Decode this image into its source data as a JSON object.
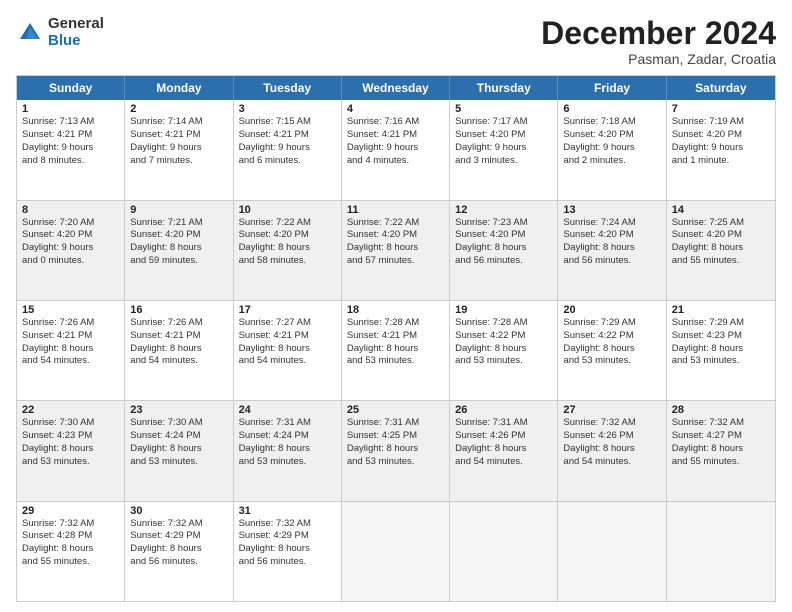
{
  "header": {
    "logo_general": "General",
    "logo_blue": "Blue",
    "title": "December 2024",
    "location": "Pasman, Zadar, Croatia"
  },
  "days_of_week": [
    "Sunday",
    "Monday",
    "Tuesday",
    "Wednesday",
    "Thursday",
    "Friday",
    "Saturday"
  ],
  "weeks": [
    [
      {
        "day": "1",
        "lines": [
          "Sunrise: 7:13 AM",
          "Sunset: 4:21 PM",
          "Daylight: 9 hours",
          "and 8 minutes."
        ],
        "shaded": false
      },
      {
        "day": "2",
        "lines": [
          "Sunrise: 7:14 AM",
          "Sunset: 4:21 PM",
          "Daylight: 9 hours",
          "and 7 minutes."
        ],
        "shaded": false
      },
      {
        "day": "3",
        "lines": [
          "Sunrise: 7:15 AM",
          "Sunset: 4:21 PM",
          "Daylight: 9 hours",
          "and 6 minutes."
        ],
        "shaded": false
      },
      {
        "day": "4",
        "lines": [
          "Sunrise: 7:16 AM",
          "Sunset: 4:21 PM",
          "Daylight: 9 hours",
          "and 4 minutes."
        ],
        "shaded": false
      },
      {
        "day": "5",
        "lines": [
          "Sunrise: 7:17 AM",
          "Sunset: 4:20 PM",
          "Daylight: 9 hours",
          "and 3 minutes."
        ],
        "shaded": false
      },
      {
        "day": "6",
        "lines": [
          "Sunrise: 7:18 AM",
          "Sunset: 4:20 PM",
          "Daylight: 9 hours",
          "and 2 minutes."
        ],
        "shaded": false
      },
      {
        "day": "7",
        "lines": [
          "Sunrise: 7:19 AM",
          "Sunset: 4:20 PM",
          "Daylight: 9 hours",
          "and 1 minute."
        ],
        "shaded": false
      }
    ],
    [
      {
        "day": "8",
        "lines": [
          "Sunrise: 7:20 AM",
          "Sunset: 4:20 PM",
          "Daylight: 9 hours",
          "and 0 minutes."
        ],
        "shaded": true
      },
      {
        "day": "9",
        "lines": [
          "Sunrise: 7:21 AM",
          "Sunset: 4:20 PM",
          "Daylight: 8 hours",
          "and 59 minutes."
        ],
        "shaded": true
      },
      {
        "day": "10",
        "lines": [
          "Sunrise: 7:22 AM",
          "Sunset: 4:20 PM",
          "Daylight: 8 hours",
          "and 58 minutes."
        ],
        "shaded": true
      },
      {
        "day": "11",
        "lines": [
          "Sunrise: 7:22 AM",
          "Sunset: 4:20 PM",
          "Daylight: 8 hours",
          "and 57 minutes."
        ],
        "shaded": true
      },
      {
        "day": "12",
        "lines": [
          "Sunrise: 7:23 AM",
          "Sunset: 4:20 PM",
          "Daylight: 8 hours",
          "and 56 minutes."
        ],
        "shaded": true
      },
      {
        "day": "13",
        "lines": [
          "Sunrise: 7:24 AM",
          "Sunset: 4:20 PM",
          "Daylight: 8 hours",
          "and 56 minutes."
        ],
        "shaded": true
      },
      {
        "day": "14",
        "lines": [
          "Sunrise: 7:25 AM",
          "Sunset: 4:20 PM",
          "Daylight: 8 hours",
          "and 55 minutes."
        ],
        "shaded": true
      }
    ],
    [
      {
        "day": "15",
        "lines": [
          "Sunrise: 7:26 AM",
          "Sunset: 4:21 PM",
          "Daylight: 8 hours",
          "and 54 minutes."
        ],
        "shaded": false
      },
      {
        "day": "16",
        "lines": [
          "Sunrise: 7:26 AM",
          "Sunset: 4:21 PM",
          "Daylight: 8 hours",
          "and 54 minutes."
        ],
        "shaded": false
      },
      {
        "day": "17",
        "lines": [
          "Sunrise: 7:27 AM",
          "Sunset: 4:21 PM",
          "Daylight: 8 hours",
          "and 54 minutes."
        ],
        "shaded": false
      },
      {
        "day": "18",
        "lines": [
          "Sunrise: 7:28 AM",
          "Sunset: 4:21 PM",
          "Daylight: 8 hours",
          "and 53 minutes."
        ],
        "shaded": false
      },
      {
        "day": "19",
        "lines": [
          "Sunrise: 7:28 AM",
          "Sunset: 4:22 PM",
          "Daylight: 8 hours",
          "and 53 minutes."
        ],
        "shaded": false
      },
      {
        "day": "20",
        "lines": [
          "Sunrise: 7:29 AM",
          "Sunset: 4:22 PM",
          "Daylight: 8 hours",
          "and 53 minutes."
        ],
        "shaded": false
      },
      {
        "day": "21",
        "lines": [
          "Sunrise: 7:29 AM",
          "Sunset: 4:23 PM",
          "Daylight: 8 hours",
          "and 53 minutes."
        ],
        "shaded": false
      }
    ],
    [
      {
        "day": "22",
        "lines": [
          "Sunrise: 7:30 AM",
          "Sunset: 4:23 PM",
          "Daylight: 8 hours",
          "and 53 minutes."
        ],
        "shaded": true
      },
      {
        "day": "23",
        "lines": [
          "Sunrise: 7:30 AM",
          "Sunset: 4:24 PM",
          "Daylight: 8 hours",
          "and 53 minutes."
        ],
        "shaded": true
      },
      {
        "day": "24",
        "lines": [
          "Sunrise: 7:31 AM",
          "Sunset: 4:24 PM",
          "Daylight: 8 hours",
          "and 53 minutes."
        ],
        "shaded": true
      },
      {
        "day": "25",
        "lines": [
          "Sunrise: 7:31 AM",
          "Sunset: 4:25 PM",
          "Daylight: 8 hours",
          "and 53 minutes."
        ],
        "shaded": true
      },
      {
        "day": "26",
        "lines": [
          "Sunrise: 7:31 AM",
          "Sunset: 4:26 PM",
          "Daylight: 8 hours",
          "and 54 minutes."
        ],
        "shaded": true
      },
      {
        "day": "27",
        "lines": [
          "Sunrise: 7:32 AM",
          "Sunset: 4:26 PM",
          "Daylight: 8 hours",
          "and 54 minutes."
        ],
        "shaded": true
      },
      {
        "day": "28",
        "lines": [
          "Sunrise: 7:32 AM",
          "Sunset: 4:27 PM",
          "Daylight: 8 hours",
          "and 55 minutes."
        ],
        "shaded": true
      }
    ],
    [
      {
        "day": "29",
        "lines": [
          "Sunrise: 7:32 AM",
          "Sunset: 4:28 PM",
          "Daylight: 8 hours",
          "and 55 minutes."
        ],
        "shaded": false
      },
      {
        "day": "30",
        "lines": [
          "Sunrise: 7:32 AM",
          "Sunset: 4:29 PM",
          "Daylight: 8 hours",
          "and 56 minutes."
        ],
        "shaded": false
      },
      {
        "day": "31",
        "lines": [
          "Sunrise: 7:32 AM",
          "Sunset: 4:29 PM",
          "Daylight: 8 hours",
          "and 56 minutes."
        ],
        "shaded": false
      },
      {
        "day": "",
        "lines": [],
        "shaded": false,
        "empty": true
      },
      {
        "day": "",
        "lines": [],
        "shaded": false,
        "empty": true
      },
      {
        "day": "",
        "lines": [],
        "shaded": false,
        "empty": true
      },
      {
        "day": "",
        "lines": [],
        "shaded": false,
        "empty": true
      }
    ]
  ]
}
